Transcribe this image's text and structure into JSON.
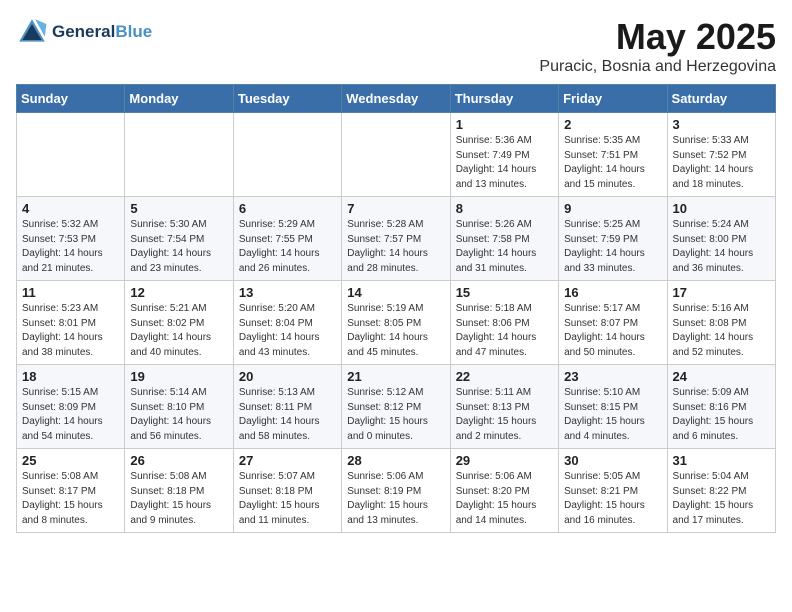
{
  "header": {
    "logo_line1": "General",
    "logo_line2": "Blue",
    "month_title": "May 2025",
    "location": "Puracic, Bosnia and Herzegovina"
  },
  "weekdays": [
    "Sunday",
    "Monday",
    "Tuesday",
    "Wednesday",
    "Thursday",
    "Friday",
    "Saturday"
  ],
  "weeks": [
    [
      {
        "day": "",
        "info": ""
      },
      {
        "day": "",
        "info": ""
      },
      {
        "day": "",
        "info": ""
      },
      {
        "day": "",
        "info": ""
      },
      {
        "day": "1",
        "info": "Sunrise: 5:36 AM\nSunset: 7:49 PM\nDaylight: 14 hours\nand 13 minutes."
      },
      {
        "day": "2",
        "info": "Sunrise: 5:35 AM\nSunset: 7:51 PM\nDaylight: 14 hours\nand 15 minutes."
      },
      {
        "day": "3",
        "info": "Sunrise: 5:33 AM\nSunset: 7:52 PM\nDaylight: 14 hours\nand 18 minutes."
      }
    ],
    [
      {
        "day": "4",
        "info": "Sunrise: 5:32 AM\nSunset: 7:53 PM\nDaylight: 14 hours\nand 21 minutes."
      },
      {
        "day": "5",
        "info": "Sunrise: 5:30 AM\nSunset: 7:54 PM\nDaylight: 14 hours\nand 23 minutes."
      },
      {
        "day": "6",
        "info": "Sunrise: 5:29 AM\nSunset: 7:55 PM\nDaylight: 14 hours\nand 26 minutes."
      },
      {
        "day": "7",
        "info": "Sunrise: 5:28 AM\nSunset: 7:57 PM\nDaylight: 14 hours\nand 28 minutes."
      },
      {
        "day": "8",
        "info": "Sunrise: 5:26 AM\nSunset: 7:58 PM\nDaylight: 14 hours\nand 31 minutes."
      },
      {
        "day": "9",
        "info": "Sunrise: 5:25 AM\nSunset: 7:59 PM\nDaylight: 14 hours\nand 33 minutes."
      },
      {
        "day": "10",
        "info": "Sunrise: 5:24 AM\nSunset: 8:00 PM\nDaylight: 14 hours\nand 36 minutes."
      }
    ],
    [
      {
        "day": "11",
        "info": "Sunrise: 5:23 AM\nSunset: 8:01 PM\nDaylight: 14 hours\nand 38 minutes."
      },
      {
        "day": "12",
        "info": "Sunrise: 5:21 AM\nSunset: 8:02 PM\nDaylight: 14 hours\nand 40 minutes."
      },
      {
        "day": "13",
        "info": "Sunrise: 5:20 AM\nSunset: 8:04 PM\nDaylight: 14 hours\nand 43 minutes."
      },
      {
        "day": "14",
        "info": "Sunrise: 5:19 AM\nSunset: 8:05 PM\nDaylight: 14 hours\nand 45 minutes."
      },
      {
        "day": "15",
        "info": "Sunrise: 5:18 AM\nSunset: 8:06 PM\nDaylight: 14 hours\nand 47 minutes."
      },
      {
        "day": "16",
        "info": "Sunrise: 5:17 AM\nSunset: 8:07 PM\nDaylight: 14 hours\nand 50 minutes."
      },
      {
        "day": "17",
        "info": "Sunrise: 5:16 AM\nSunset: 8:08 PM\nDaylight: 14 hours\nand 52 minutes."
      }
    ],
    [
      {
        "day": "18",
        "info": "Sunrise: 5:15 AM\nSunset: 8:09 PM\nDaylight: 14 hours\nand 54 minutes."
      },
      {
        "day": "19",
        "info": "Sunrise: 5:14 AM\nSunset: 8:10 PM\nDaylight: 14 hours\nand 56 minutes."
      },
      {
        "day": "20",
        "info": "Sunrise: 5:13 AM\nSunset: 8:11 PM\nDaylight: 14 hours\nand 58 minutes."
      },
      {
        "day": "21",
        "info": "Sunrise: 5:12 AM\nSunset: 8:12 PM\nDaylight: 15 hours\nand 0 minutes."
      },
      {
        "day": "22",
        "info": "Sunrise: 5:11 AM\nSunset: 8:13 PM\nDaylight: 15 hours\nand 2 minutes."
      },
      {
        "day": "23",
        "info": "Sunrise: 5:10 AM\nSunset: 8:15 PM\nDaylight: 15 hours\nand 4 minutes."
      },
      {
        "day": "24",
        "info": "Sunrise: 5:09 AM\nSunset: 8:16 PM\nDaylight: 15 hours\nand 6 minutes."
      }
    ],
    [
      {
        "day": "25",
        "info": "Sunrise: 5:08 AM\nSunset: 8:17 PM\nDaylight: 15 hours\nand 8 minutes."
      },
      {
        "day": "26",
        "info": "Sunrise: 5:08 AM\nSunset: 8:18 PM\nDaylight: 15 hours\nand 9 minutes."
      },
      {
        "day": "27",
        "info": "Sunrise: 5:07 AM\nSunset: 8:18 PM\nDaylight: 15 hours\nand 11 minutes."
      },
      {
        "day": "28",
        "info": "Sunrise: 5:06 AM\nSunset: 8:19 PM\nDaylight: 15 hours\nand 13 minutes."
      },
      {
        "day": "29",
        "info": "Sunrise: 5:06 AM\nSunset: 8:20 PM\nDaylight: 15 hours\nand 14 minutes."
      },
      {
        "day": "30",
        "info": "Sunrise: 5:05 AM\nSunset: 8:21 PM\nDaylight: 15 hours\nand 16 minutes."
      },
      {
        "day": "31",
        "info": "Sunrise: 5:04 AM\nSunset: 8:22 PM\nDaylight: 15 hours\nand 17 minutes."
      }
    ]
  ]
}
